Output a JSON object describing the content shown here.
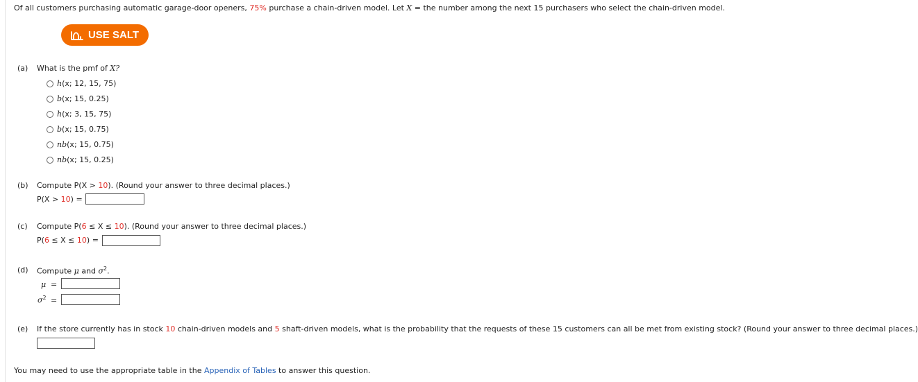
{
  "problem": {
    "intro_pre": "Of all customers purchasing automatic garage-door openers, ",
    "intro_percent": "75%",
    "intro_mid": " purchase a chain-driven model. Let ",
    "intro_var": "X",
    "intro_post": " = the number among the next 15 purchasers who select the chain-driven model."
  },
  "salt_button": {
    "label": "USE SALT",
    "icon": "salt-icon",
    "color": "#f36c00"
  },
  "part_a": {
    "tag": "(a)",
    "question_pre": "What is the pmf of ",
    "question_var": "X?",
    "options": [
      {
        "fn": "h",
        "args": "(x; 12, 15, 75)"
      },
      {
        "fn": "b",
        "args": "(x; 15, 0.25)"
      },
      {
        "fn": "h",
        "args": "(x; 3, 15, 75)"
      },
      {
        "fn": "b",
        "args": "(x; 15, 0.75)"
      },
      {
        "fn": "nb",
        "args": "(x; 15, 0.75)"
      },
      {
        "fn": "nb",
        "args": "(x; 15, 0.25)"
      }
    ]
  },
  "part_b": {
    "tag": "(b)",
    "q_pre": "Compute ",
    "q_expr_a": "P(X > ",
    "q_num": "10",
    "q_expr_b": ").",
    "q_post": " (Round your answer to three decimal places.)",
    "ans_a": "P(X > ",
    "ans_num": "10",
    "ans_b": ") ="
  },
  "part_c": {
    "tag": "(c)",
    "q_pre": "Compute ",
    "q_expr_a": "P(",
    "q_num1": "6",
    "q_expr_b": " ≤ X ≤ ",
    "q_num2": "10",
    "q_expr_c": ").",
    "q_post": " (Round your answer to three decimal places.)",
    "ans_a": "P(",
    "ans_num1": "6",
    "ans_b": " ≤ X ≤ ",
    "ans_num2": "10",
    "ans_c": ") ="
  },
  "part_d": {
    "tag": "(d)",
    "q_pre": "Compute ",
    "q_mu": "μ",
    "q_and": " and ",
    "q_sigma": "σ",
    "q_exp": "2",
    "q_end": ".",
    "mu_label": "μ",
    "sigma_label": "σ",
    "sigma_exp": "2",
    "eq": "="
  },
  "part_e": {
    "tag": "(e)",
    "q_pre": "If the store currently has in stock ",
    "q_num1": "10",
    "q_mid": " chain-driven models and ",
    "q_num2": "5",
    "q_post": " shaft-driven models, what is the probability that the requests of these 15 customers can all be met from existing stock? (Round your answer to three decimal places.)"
  },
  "footer": {
    "pre": "You may need to use the appropriate table in the ",
    "link": "Appendix of Tables",
    "post": " to answer this question."
  },
  "colors": {
    "accent_red": "#e0302a",
    "link_blue": "#2a64b8",
    "salt_orange": "#f36c00"
  }
}
